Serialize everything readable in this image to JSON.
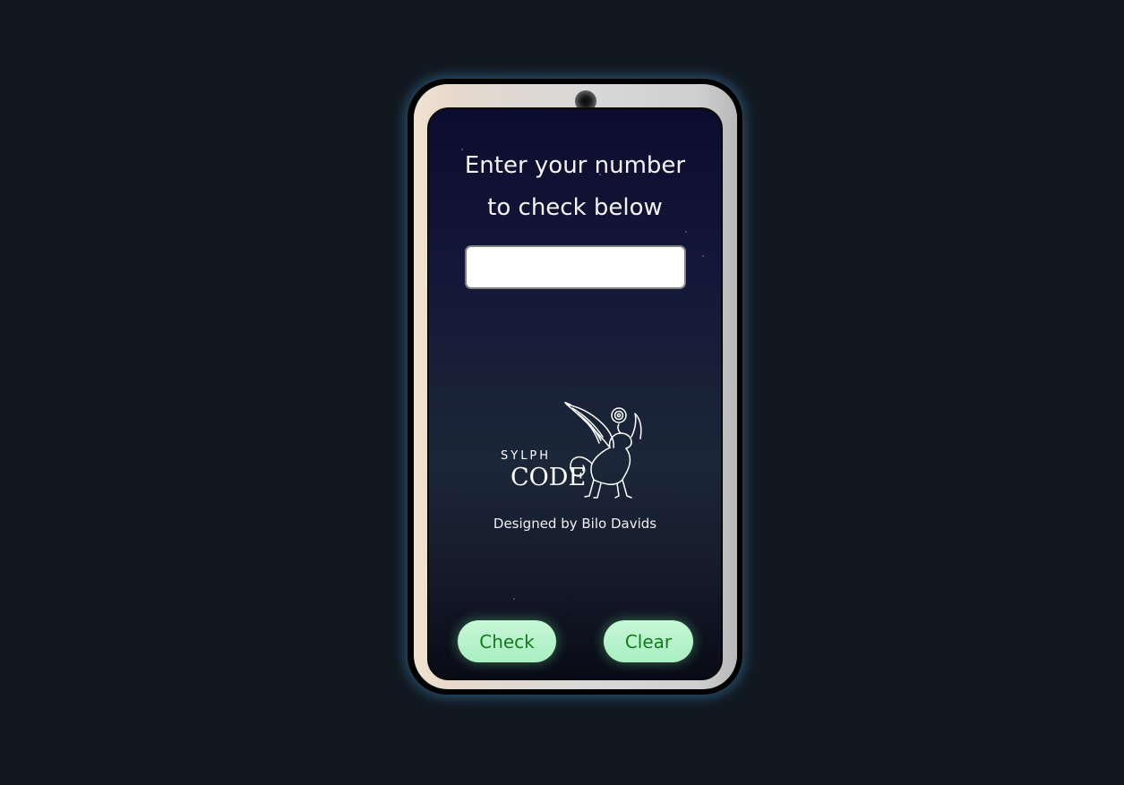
{
  "prompt": {
    "line1": "Enter your number",
    "line2": "to check below"
  },
  "number_input": {
    "value": "",
    "placeholder": ""
  },
  "logo": {
    "word_top": "SYLPH",
    "word_bottom": "CODE"
  },
  "credit": "Designed by Bilo Davids",
  "buttons": {
    "check": "Check",
    "clear": "Clear"
  },
  "colors": {
    "page_background": "#111820",
    "button_background": "#b8f3cc",
    "button_text": "#137b1e",
    "input_background": "#ffffff"
  }
}
